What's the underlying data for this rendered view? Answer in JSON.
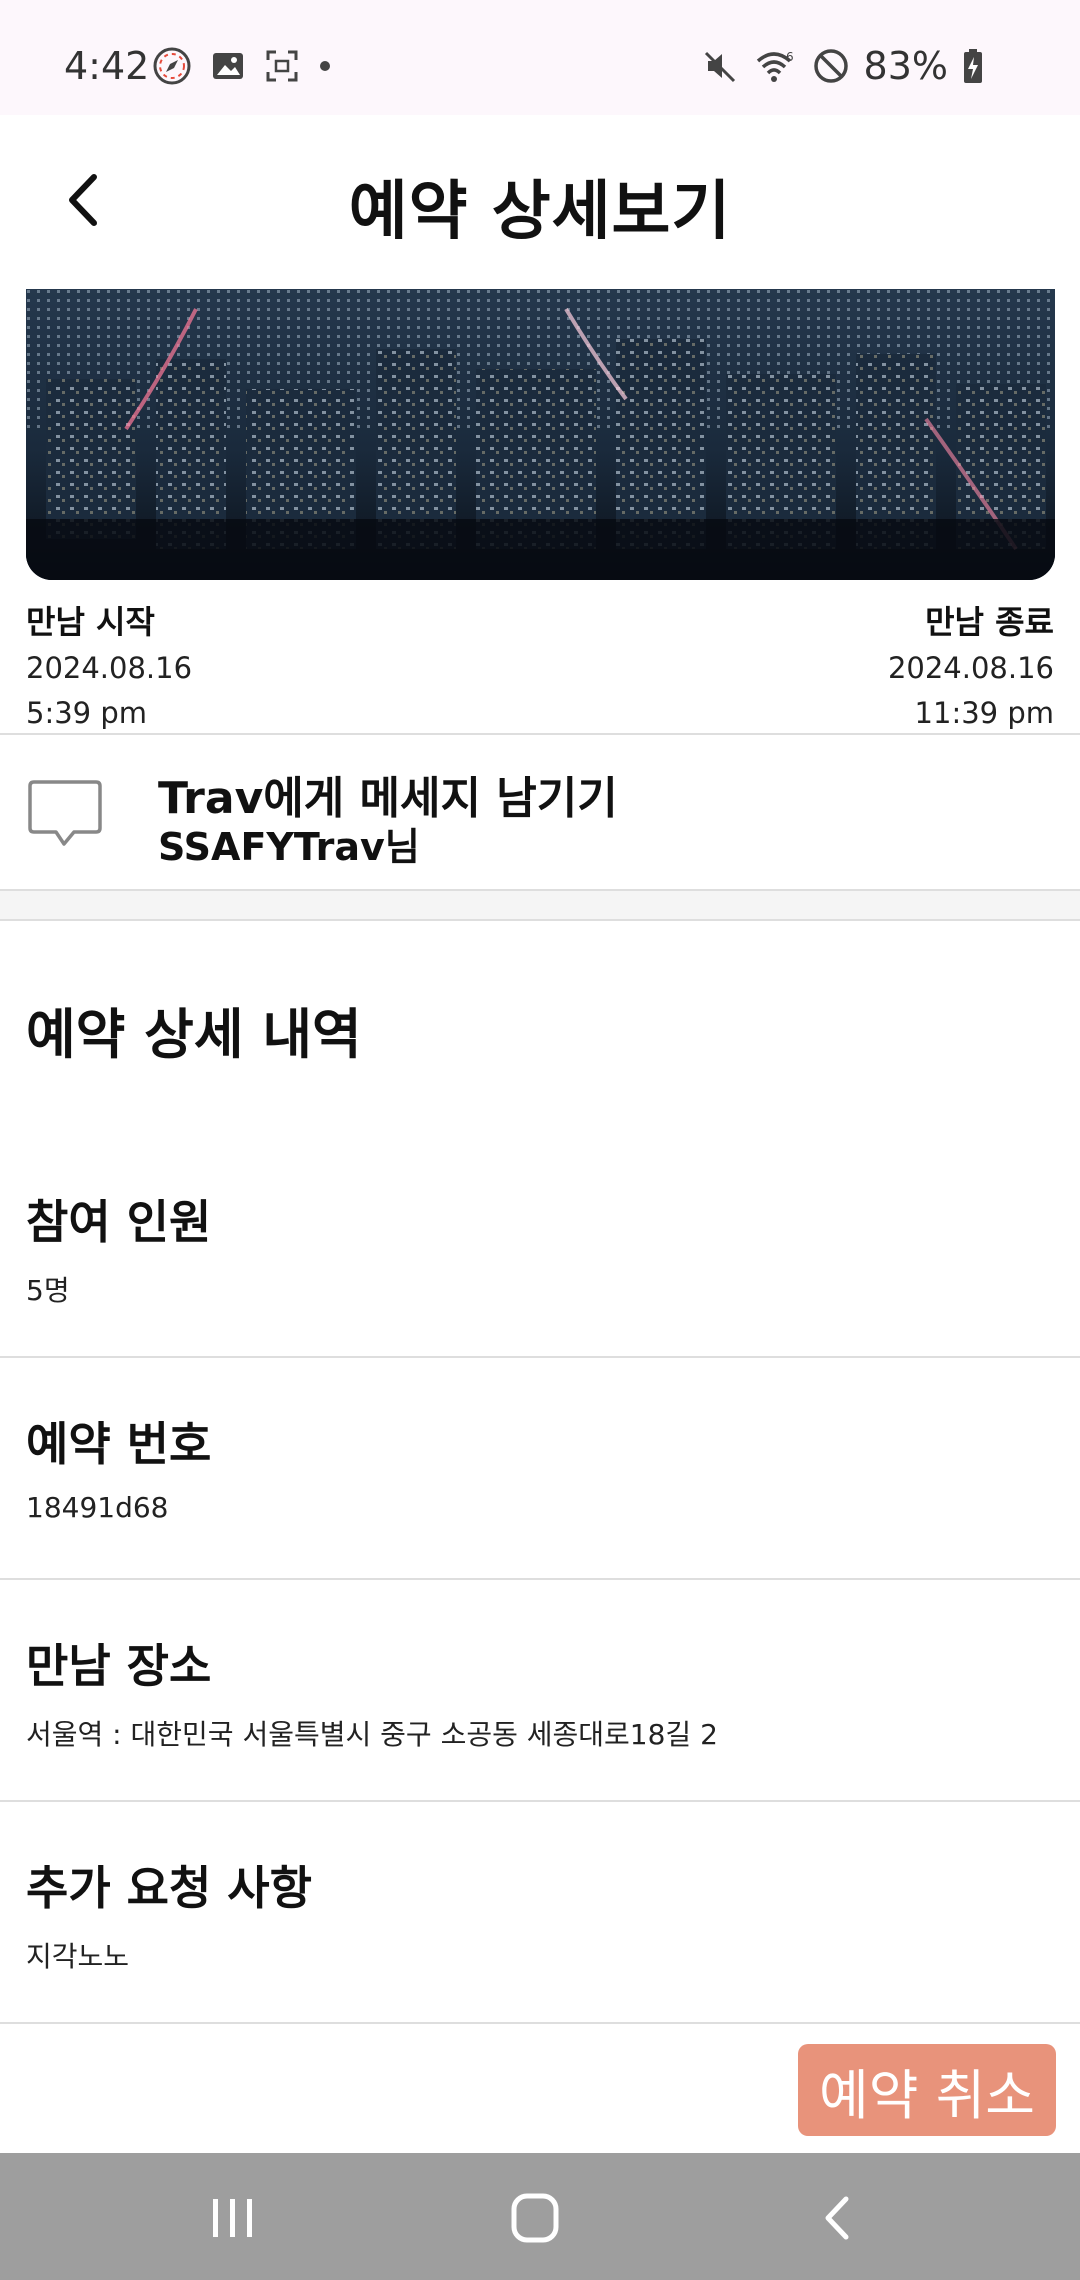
{
  "status_bar": {
    "time": "4:42",
    "battery": "83%",
    "left_icons": [
      "compass-icon",
      "image-icon",
      "screenshot-icon",
      "dot-icon"
    ],
    "right_icons": [
      "mute-icon",
      "wifi-icon",
      "dnd-icon",
      "battery-charging-icon"
    ]
  },
  "header": {
    "title": "예약 상세보기",
    "back_icon": "chevron-left-icon"
  },
  "meeting": {
    "start_label": "만남 시작",
    "start_date": "2024.08.16",
    "start_time": "5:39 pm",
    "end_label": "만남 종료",
    "end_date": "2024.08.16",
    "end_time": "11:39 pm"
  },
  "message": {
    "title": "Trav에게 메세지 남기기",
    "subtitle": "SSAFYTrav님",
    "icon": "chat-bubble-icon"
  },
  "details": {
    "section_title": "예약 상세 내역",
    "items": [
      {
        "label": "참여 인원",
        "value": "5명"
      },
      {
        "label": "예약 번호",
        "value": "18491d68"
      },
      {
        "label": "만남 장소",
        "value": "서울역 : 대한민국 서울특별시 중구 소공동 세종대로18길 2"
      },
      {
        "label": "추가 요청 사항",
        "value": "지각노노"
      }
    ]
  },
  "actions": {
    "cancel_label": "예약 취소"
  },
  "colors": {
    "cancel_button": "#e8937b",
    "status_bar_bg": "#fdf7fc",
    "nav_bar_bg": "#9e9e9e"
  },
  "nav_bar": {
    "icons": [
      "recent-apps-icon",
      "home-icon",
      "back-icon"
    ]
  }
}
